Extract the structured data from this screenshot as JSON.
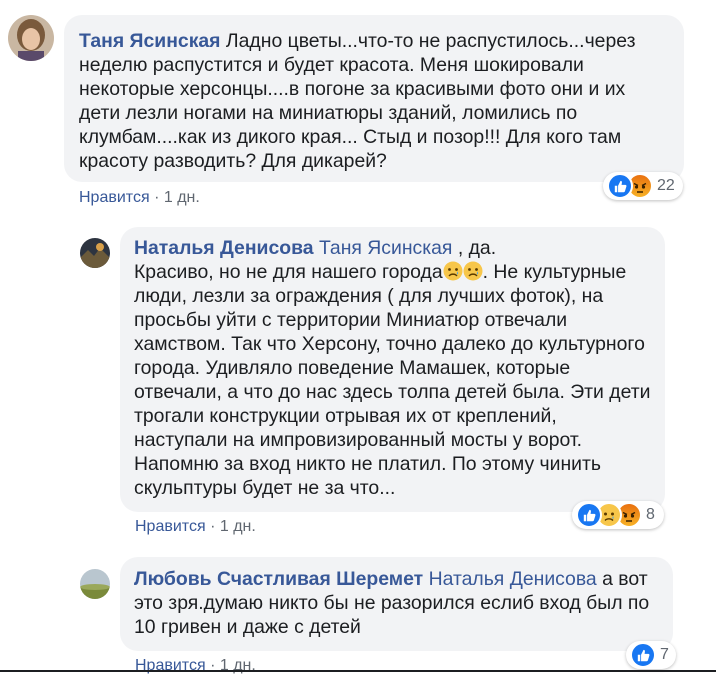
{
  "comments": [
    {
      "author": "Таня Ясинская",
      "text": "Ладно цветы...что-то не распустилось...через неделю распустится и будет красота. Меня шокировали некоторые херсонцы....в погоне за красивыми фото они и их дети лезли ногами на миниатюры зданий, ломились по клумбам....как из дикого края... Стыд и позор!!! Для кого там красоту разводить? Для дикарей?",
      "like_label": "Нравится",
      "separator": "·",
      "time": "1 дн.",
      "reaction_count": "22",
      "reactions": [
        "like-icon",
        "angry-icon"
      ]
    },
    {
      "author": "Наталья Денисова",
      "mention": "Таня Ясинская",
      "mention_suffix": ", да.",
      "text_before_emoji": "Красиво, но не для нашего города",
      "text_after_emoji": ". Не культурные люди, лезли за ограждения ( для лучших фоток), на просьбы уйти с территории Миниатюр отвечали хамством. Так что Херсону, точно далеко до культурного города. Удивляло поведение Мамашек, которые отвечали, а что до нас здесь толпа детей была. Эти дети трогали конструкции отрывая их от креплений, наступали на импровизированный мосты у ворот. Напомню за вход никто не платил. По этому чинить скульптуры будет не за что...",
      "like_label": "Нравится",
      "separator": "·",
      "time": "1 дн.",
      "reaction_count": "8",
      "reactions": [
        "like-icon",
        "sad-icon",
        "angry-icon"
      ]
    },
    {
      "author": "Любовь Счастливая Шеремет",
      "mention": "Наталья Денисова",
      "text": "а вот это зря.думаю никто бы не разорился еслиб вход был по 10 гривен и даже с детей",
      "like_label": "Нравится",
      "separator": "·",
      "time": "1 дн.",
      "reaction_count": "7",
      "reactions": [
        "like-icon"
      ]
    }
  ],
  "colors": {
    "link": "#385898",
    "bubble": "#f2f3f5",
    "meta": "#606770",
    "like": "#1877f2",
    "angry": "#e9710f",
    "sad": "#f7b125"
  }
}
